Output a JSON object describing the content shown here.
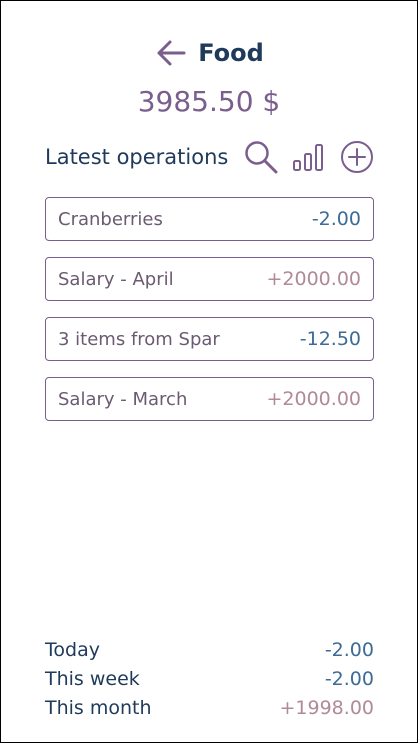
{
  "header": {
    "title": "Food",
    "back_icon": "arrow-left-icon"
  },
  "balance": "3985.50 $",
  "operations": {
    "title": "Latest operations",
    "tools": [
      "search-icon",
      "bar-chart-icon",
      "add-circle-icon"
    ],
    "items": [
      {
        "name": "Cranberries",
        "amount": "-2.00",
        "type": "negative"
      },
      {
        "name": "Salary - April",
        "amount": "+2000.00",
        "type": "positive"
      },
      {
        "name": "3 items from Spar",
        "amount": "-12.50",
        "type": "negative"
      },
      {
        "name": "Salary - March",
        "amount": "+2000.00",
        "type": "positive"
      }
    ]
  },
  "summary": [
    {
      "label": "Today",
      "value": "-2.00",
      "type": "negative"
    },
    {
      "label": "This week",
      "value": "-2.00",
      "type": "negative"
    },
    {
      "label": "This month",
      "value": "+1998.00",
      "type": "positive"
    }
  ],
  "colors": {
    "title": "#1f3a5a",
    "accent": "#7a5e8e",
    "negative": "#3d6b96",
    "positive": "#b08a96"
  }
}
